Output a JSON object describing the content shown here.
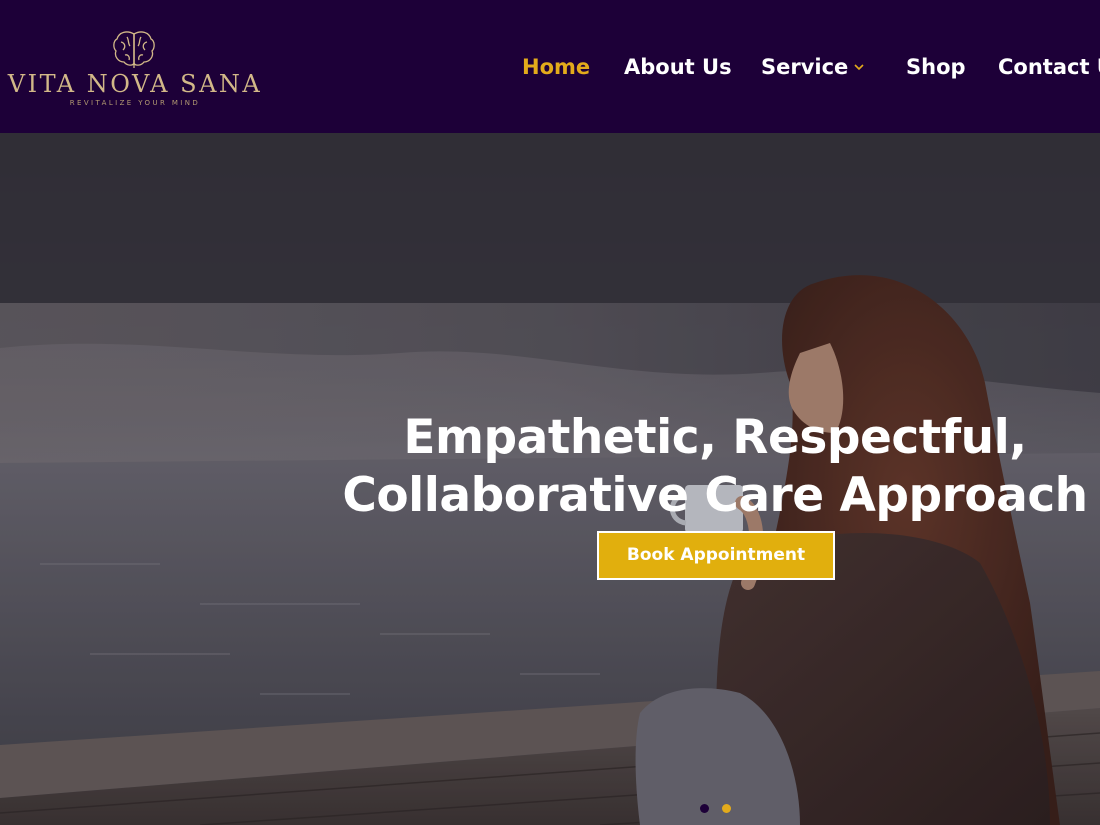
{
  "brand": {
    "name": "VITA NOVA SANA",
    "tagline": "REVITALIZE YOUR MIND",
    "logo_icon": "brain-icon",
    "gold": "#d2b888"
  },
  "nav": {
    "items": [
      {
        "label": "Home",
        "active": true
      },
      {
        "label": "About Us",
        "active": false
      },
      {
        "label": "Service",
        "active": false,
        "dropdown": true
      },
      {
        "label": "Shop",
        "active": false
      },
      {
        "label": "Contact Us",
        "active": false
      }
    ],
    "active_color": "#e3ab1b",
    "background": "#1d0038"
  },
  "hero": {
    "title_line1": "Empathetic, Respectful,",
    "title_line2": "Collaborative Care Approach",
    "cta_label": "Book Appointment",
    "cta_color": "#e1af0d",
    "slider": {
      "total": 2,
      "active": 2
    }
  }
}
